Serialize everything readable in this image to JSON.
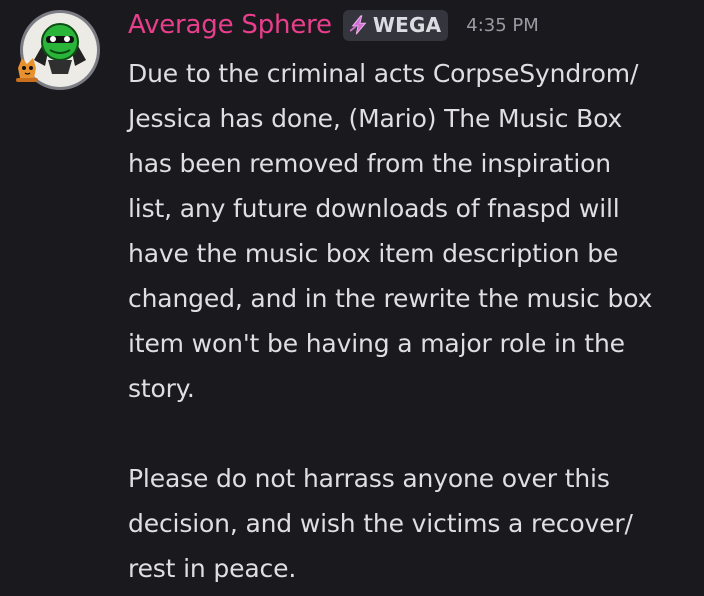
{
  "message": {
    "author": "Average Sphere",
    "author_color": "#e83e8c",
    "tag": {
      "icon": "lightning-icon",
      "label": "WEGA"
    },
    "timestamp": "4:35 PM",
    "paragraphs": [
      [
        "Due to the criminal acts CorpseSyndrom/",
        "Jessica has done, (Mario) The Music Box",
        "has been removed from the inspiration",
        "list, any future downloads of fnaspd will",
        "have the music box item description be",
        "changed, and in the rewrite the music box",
        "item won't be having a major role in the",
        "story."
      ],
      [
        "Please do not harrass anyone over this",
        "decision, and wish the victims a recover/",
        "rest in peace."
      ]
    ]
  }
}
